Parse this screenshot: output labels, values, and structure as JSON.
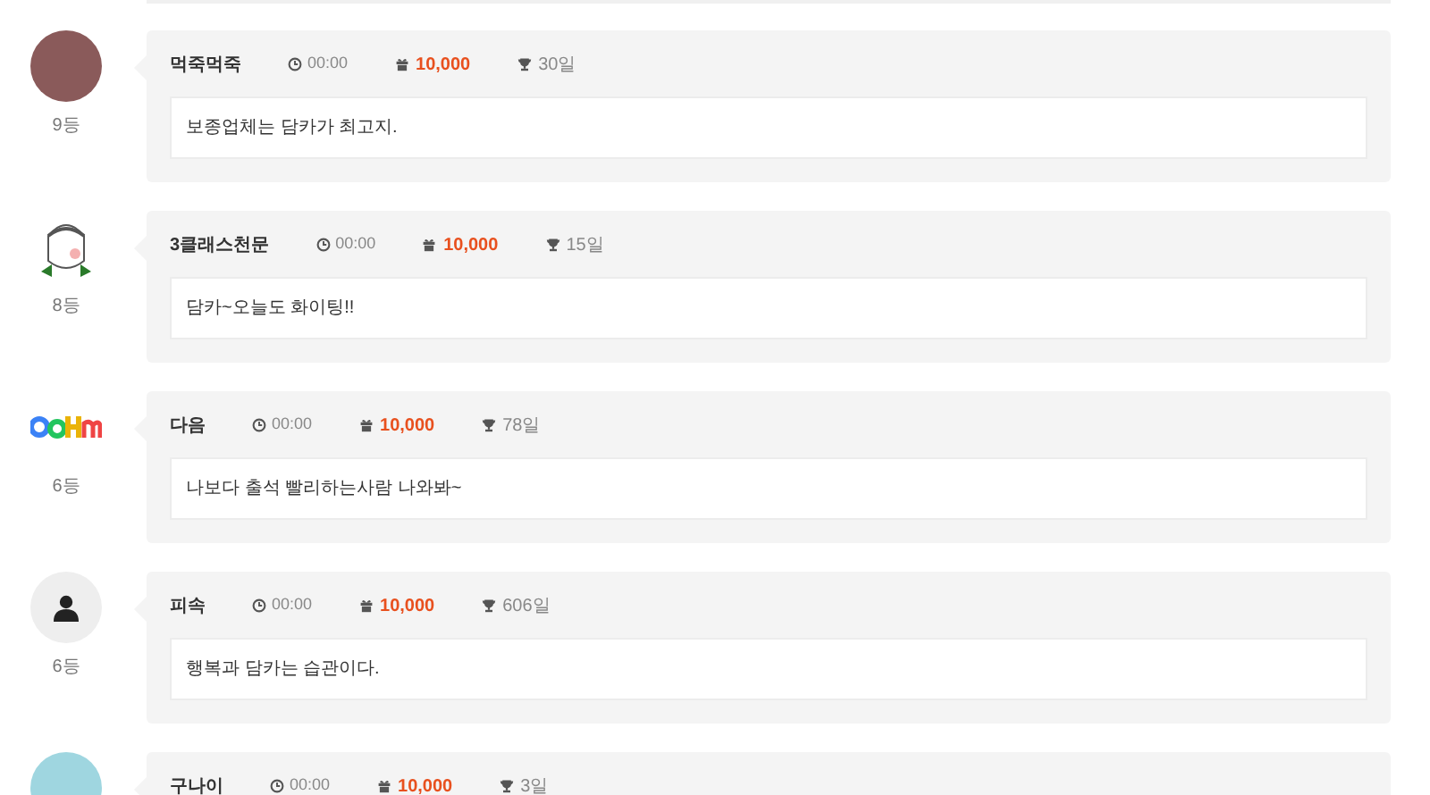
{
  "entries": [
    {
      "kind": "photo",
      "rank": "9등",
      "name": "먹죽먹죽",
      "time": "00:00",
      "points": "10,000",
      "days": "30일",
      "message": "보종업체는 담카가 최고지."
    },
    {
      "kind": "sketch",
      "rank": "8등",
      "name": "3클래스천문",
      "time": "00:00",
      "points": "10,000",
      "days": "15일",
      "message": "담카~오늘도 화이팅!!"
    },
    {
      "kind": "logo",
      "rank": "6등",
      "name": "다음",
      "time": "00:00",
      "points": "10,000",
      "days": "78일",
      "message": "나보다 출석 빨리하는사람 나와봐~"
    },
    {
      "kind": "default",
      "rank": "6등",
      "name": "피속",
      "time": "00:00",
      "points": "10,000",
      "days": "606일",
      "message": "행복과 담카는 습관이다."
    },
    {
      "kind": "photo2",
      "name": "구나이",
      "time": "00:00",
      "points": "10,000",
      "days": "3일"
    }
  ]
}
